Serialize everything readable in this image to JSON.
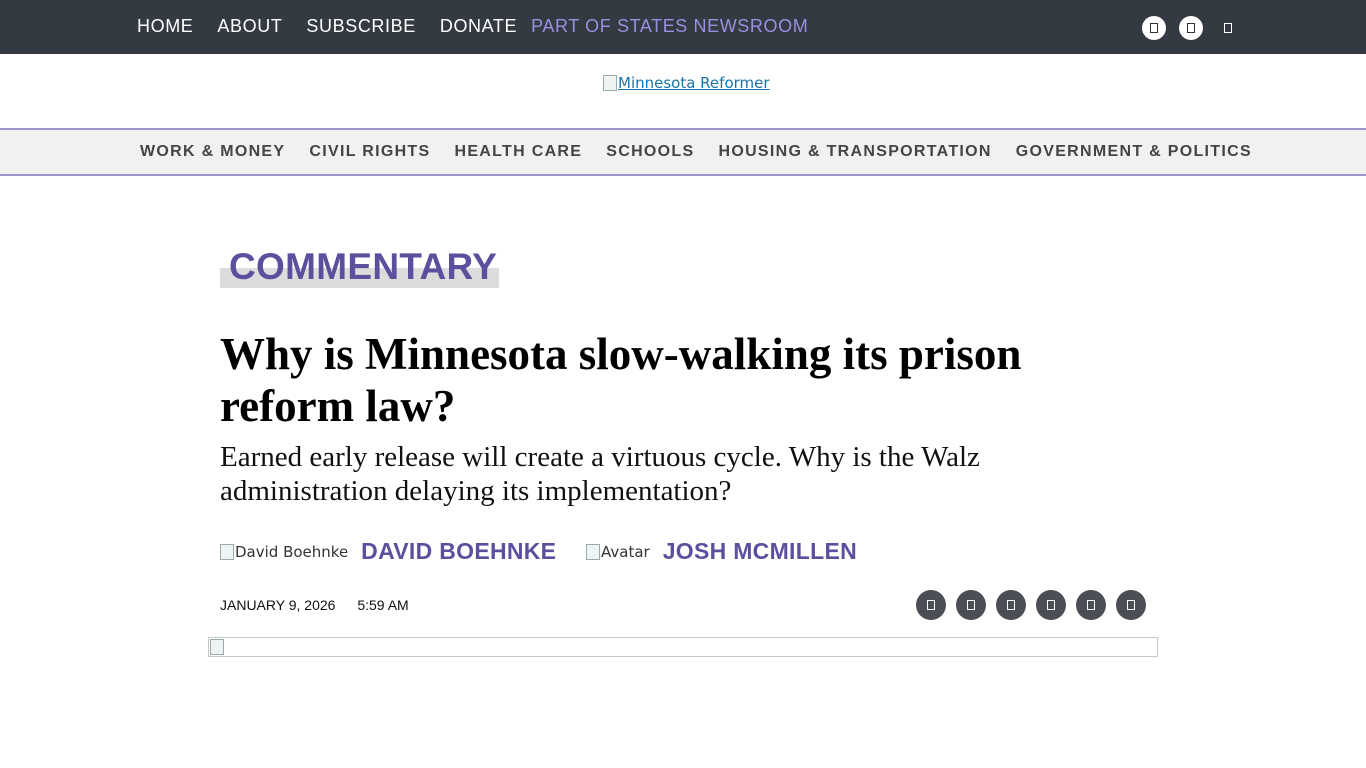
{
  "topbar": {
    "links": [
      "HOME",
      "ABOUT",
      "SUBSCRIBE",
      "DONATE"
    ],
    "network_label": "PART OF STATES NEWSROOM",
    "social_icons": [
      "facebook-icon",
      "instagram-icon",
      "twitter-icon"
    ],
    "colors": {
      "background": "#333a42",
      "network": "#9b8fe0"
    }
  },
  "logo": {
    "alt": "Minnesota Reformer"
  },
  "category_nav": {
    "items": [
      "WORK & MONEY",
      "CIVIL RIGHTS",
      "HEALTH CARE",
      "SCHOOLS",
      "HOUSING & TRANSPORTATION",
      "GOVERNMENT & POLITICS"
    ]
  },
  "article": {
    "kicker": "COMMENTARY",
    "headline": "Why is Minnesota slow-walking its prison reform law?",
    "dek": "Earned early release will create a virtuous cycle. Why is the Walz administration delaying its implementation?",
    "authors": [
      {
        "image_alt": "David Boehnke",
        "name": "DAVID BOEHNKE"
      },
      {
        "image_alt": "Avatar",
        "name": "JOSH MCMILLEN"
      }
    ],
    "date": "JANUARY 9, 2026",
    "time": "5:59 AM",
    "share_icons": [
      "facebook-icon",
      "twitter-icon",
      "linkedin-icon",
      "email-icon",
      "print-icon",
      "link-icon"
    ],
    "accent_color": "#5c4f9e"
  }
}
